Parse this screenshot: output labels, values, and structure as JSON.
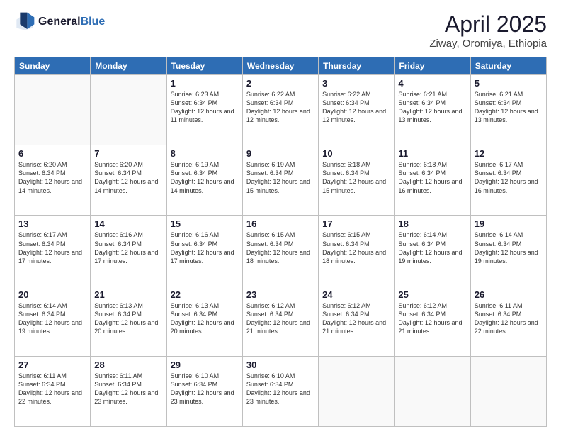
{
  "header": {
    "logo_line1": "General",
    "logo_line2": "Blue",
    "title": "April 2025",
    "subtitle": "Ziway, Oromiya, Ethiopia"
  },
  "weekdays": [
    "Sunday",
    "Monday",
    "Tuesday",
    "Wednesday",
    "Thursday",
    "Friday",
    "Saturday"
  ],
  "weeks": [
    [
      {
        "day": "",
        "info": ""
      },
      {
        "day": "",
        "info": ""
      },
      {
        "day": "1",
        "info": "Sunrise: 6:23 AM\nSunset: 6:34 PM\nDaylight: 12 hours and 11 minutes."
      },
      {
        "day": "2",
        "info": "Sunrise: 6:22 AM\nSunset: 6:34 PM\nDaylight: 12 hours and 12 minutes."
      },
      {
        "day": "3",
        "info": "Sunrise: 6:22 AM\nSunset: 6:34 PM\nDaylight: 12 hours and 12 minutes."
      },
      {
        "day": "4",
        "info": "Sunrise: 6:21 AM\nSunset: 6:34 PM\nDaylight: 12 hours and 13 minutes."
      },
      {
        "day": "5",
        "info": "Sunrise: 6:21 AM\nSunset: 6:34 PM\nDaylight: 12 hours and 13 minutes."
      }
    ],
    [
      {
        "day": "6",
        "info": "Sunrise: 6:20 AM\nSunset: 6:34 PM\nDaylight: 12 hours and 14 minutes."
      },
      {
        "day": "7",
        "info": "Sunrise: 6:20 AM\nSunset: 6:34 PM\nDaylight: 12 hours and 14 minutes."
      },
      {
        "day": "8",
        "info": "Sunrise: 6:19 AM\nSunset: 6:34 PM\nDaylight: 12 hours and 14 minutes."
      },
      {
        "day": "9",
        "info": "Sunrise: 6:19 AM\nSunset: 6:34 PM\nDaylight: 12 hours and 15 minutes."
      },
      {
        "day": "10",
        "info": "Sunrise: 6:18 AM\nSunset: 6:34 PM\nDaylight: 12 hours and 15 minutes."
      },
      {
        "day": "11",
        "info": "Sunrise: 6:18 AM\nSunset: 6:34 PM\nDaylight: 12 hours and 16 minutes."
      },
      {
        "day": "12",
        "info": "Sunrise: 6:17 AM\nSunset: 6:34 PM\nDaylight: 12 hours and 16 minutes."
      }
    ],
    [
      {
        "day": "13",
        "info": "Sunrise: 6:17 AM\nSunset: 6:34 PM\nDaylight: 12 hours and 17 minutes."
      },
      {
        "day": "14",
        "info": "Sunrise: 6:16 AM\nSunset: 6:34 PM\nDaylight: 12 hours and 17 minutes."
      },
      {
        "day": "15",
        "info": "Sunrise: 6:16 AM\nSunset: 6:34 PM\nDaylight: 12 hours and 17 minutes."
      },
      {
        "day": "16",
        "info": "Sunrise: 6:15 AM\nSunset: 6:34 PM\nDaylight: 12 hours and 18 minutes."
      },
      {
        "day": "17",
        "info": "Sunrise: 6:15 AM\nSunset: 6:34 PM\nDaylight: 12 hours and 18 minutes."
      },
      {
        "day": "18",
        "info": "Sunrise: 6:14 AM\nSunset: 6:34 PM\nDaylight: 12 hours and 19 minutes."
      },
      {
        "day": "19",
        "info": "Sunrise: 6:14 AM\nSunset: 6:34 PM\nDaylight: 12 hours and 19 minutes."
      }
    ],
    [
      {
        "day": "20",
        "info": "Sunrise: 6:14 AM\nSunset: 6:34 PM\nDaylight: 12 hours and 19 minutes."
      },
      {
        "day": "21",
        "info": "Sunrise: 6:13 AM\nSunset: 6:34 PM\nDaylight: 12 hours and 20 minutes."
      },
      {
        "day": "22",
        "info": "Sunrise: 6:13 AM\nSunset: 6:34 PM\nDaylight: 12 hours and 20 minutes."
      },
      {
        "day": "23",
        "info": "Sunrise: 6:12 AM\nSunset: 6:34 PM\nDaylight: 12 hours and 21 minutes."
      },
      {
        "day": "24",
        "info": "Sunrise: 6:12 AM\nSunset: 6:34 PM\nDaylight: 12 hours and 21 minutes."
      },
      {
        "day": "25",
        "info": "Sunrise: 6:12 AM\nSunset: 6:34 PM\nDaylight: 12 hours and 21 minutes."
      },
      {
        "day": "26",
        "info": "Sunrise: 6:11 AM\nSunset: 6:34 PM\nDaylight: 12 hours and 22 minutes."
      }
    ],
    [
      {
        "day": "27",
        "info": "Sunrise: 6:11 AM\nSunset: 6:34 PM\nDaylight: 12 hours and 22 minutes."
      },
      {
        "day": "28",
        "info": "Sunrise: 6:11 AM\nSunset: 6:34 PM\nDaylight: 12 hours and 23 minutes."
      },
      {
        "day": "29",
        "info": "Sunrise: 6:10 AM\nSunset: 6:34 PM\nDaylight: 12 hours and 23 minutes."
      },
      {
        "day": "30",
        "info": "Sunrise: 6:10 AM\nSunset: 6:34 PM\nDaylight: 12 hours and 23 minutes."
      },
      {
        "day": "",
        "info": ""
      },
      {
        "day": "",
        "info": ""
      },
      {
        "day": "",
        "info": ""
      }
    ]
  ]
}
